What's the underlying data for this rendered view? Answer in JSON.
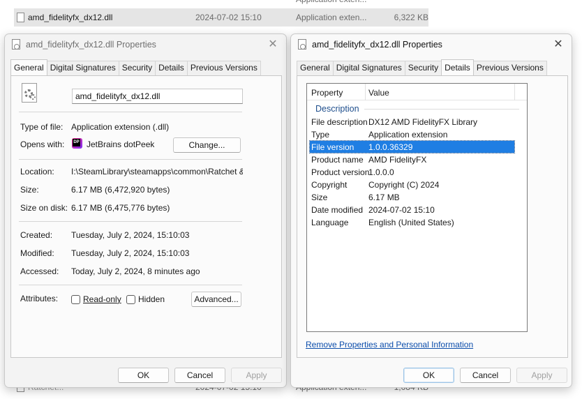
{
  "explorer": {
    "top_row": {
      "type": "Application exten..."
    },
    "selected_row": {
      "name": "amd_fidelityfx_dx12.dll",
      "date": "2024-07-02 15:10",
      "type": "Application exten...",
      "size": "6,322 KB"
    },
    "bottom_row": {
      "name": "Ratchet...",
      "date": "2024-07-02 15:10",
      "type": "Application exten...",
      "size": "1,084 KB"
    }
  },
  "left_dialog": {
    "title": "amd_fidelityfx_dx12.dll Properties",
    "close_glyph": "✕",
    "tabs": [
      {
        "label": "General"
      },
      {
        "label": "Digital Signatures"
      },
      {
        "label": "Security"
      },
      {
        "label": "Details"
      },
      {
        "label": "Previous Versions"
      }
    ],
    "active_tab": "General",
    "file_name_value": "amd_fidelityfx_dx12.dll",
    "type_of_file_label": "Type of file:",
    "type_of_file_value": "Application extension (.dll)",
    "opens_with_label": "Opens with:",
    "opens_with_value": "JetBrains dotPeek",
    "change_button": "Change...",
    "location_label": "Location:",
    "location_value": "I:\\SteamLibrary\\steamapps\\common\\Ratchet & Clar",
    "size_label": "Size:",
    "size_value": "6.17 MB (6,472,920 bytes)",
    "size_on_disk_label": "Size on disk:",
    "size_on_disk_value": "6.17 MB (6,475,776 bytes)",
    "created_label": "Created:",
    "created_value": "Tuesday, July 2, 2024, 15:10:03",
    "modified_label": "Modified:",
    "modified_value": "Tuesday, July 2, 2024, 15:10:03",
    "accessed_label": "Accessed:",
    "accessed_value": "Today, July 2, 2024, 8 minutes ago",
    "attributes_label": "Attributes:",
    "readonly_label": "Read-only",
    "hidden_label": "Hidden",
    "advanced_button": "Advanced...",
    "ok_button": "OK",
    "cancel_button": "Cancel",
    "apply_button": "Apply"
  },
  "right_dialog": {
    "title": "amd_fidelityfx_dx12.dll Properties",
    "close_glyph": "✕",
    "tabs": [
      {
        "label": "General"
      },
      {
        "label": "Digital Signatures"
      },
      {
        "label": "Security"
      },
      {
        "label": "Details"
      },
      {
        "label": "Previous Versions"
      }
    ],
    "active_tab": "Details",
    "grid_header": {
      "property": "Property",
      "value": "Value"
    },
    "group_label": "Description",
    "rows": [
      {
        "key": "File description",
        "value": "DX12 AMD FidelityFX Library"
      },
      {
        "key": "Type",
        "value": "Application extension"
      },
      {
        "key": "File version",
        "value": "1.0.0.36329",
        "selected": true
      },
      {
        "key": "Product name",
        "value": "AMD FidelityFX"
      },
      {
        "key": "Product version",
        "value": "1.0.0.0"
      },
      {
        "key": "Copyright",
        "value": "Copyright (C) 2024"
      },
      {
        "key": "Size",
        "value": "6.17 MB"
      },
      {
        "key": "Date modified",
        "value": "2024-07-02 15:10"
      },
      {
        "key": "Language",
        "value": "English (United States)"
      }
    ],
    "remove_link": "Remove Properties and Personal Information",
    "ok_button": "OK",
    "cancel_button": "Cancel",
    "apply_button": "Apply"
  },
  "colors": {
    "selection": "#1f7ee3",
    "link": "#0b4dab",
    "group_heading": "#1e4e8c"
  }
}
